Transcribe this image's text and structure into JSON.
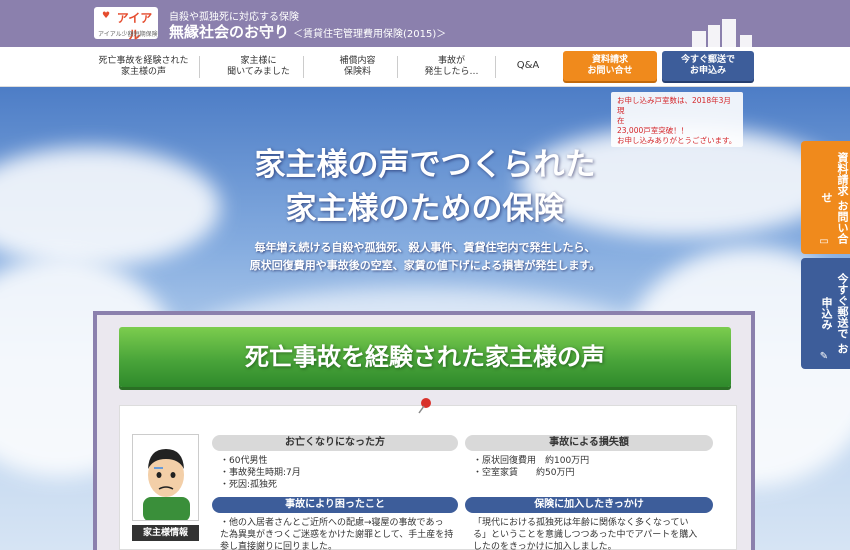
{
  "header": {
    "logo_brand": "アイアル",
    "logo_sub": "アイアル少額短期保険",
    "tagline": "自殺や孤独死に対応する保険",
    "title": "無縁社会のお守り",
    "title_sub": "＜賃貸住宅管理費用保険(2015)＞"
  },
  "nav": {
    "items": [
      {
        "line1": "死亡事故を経験された",
        "line2": "家主様の声"
      },
      {
        "line1": "家主様に",
        "line2": "聞いてみました"
      },
      {
        "line1": "補償内容",
        "line2": "保険料"
      },
      {
        "line1": "事故が",
        "line2": "発生したら…"
      }
    ],
    "qa": "Q&A",
    "request_button": {
      "line1": "資料請求",
      "line2": "お問い合せ"
    },
    "apply_button": {
      "line1": "今すぐ郵送で",
      "line2": "お申込み"
    }
  },
  "notice": {
    "line1": "お申し込み戸室数は、2018年3月現",
    "line2": "在",
    "line3": "23,000戸室突破！！",
    "line4": "お申し込みありがとうございます。"
  },
  "hero": {
    "title_line1": "家主様の声でつくられた",
    "title_line2": "家主様のための保険",
    "desc_line1": "毎年増え続ける自殺や孤独死、殺人事件、賃貸住宅内で発生したら、",
    "desc_line2": "原状回復費用や事故後の空室、家賃の値下げによる損害が発生します。"
  },
  "side": {
    "request": "資料請求 お問い合せ",
    "apply": "今すぐ郵送で お申込み"
  },
  "content": {
    "banner": "死亡事故を経験された家主様の声",
    "avatar_label": "家主様情報",
    "deceased": {
      "heading": "お亡くなりになった方",
      "items": [
        "・60代男性",
        "・事故発生時期:7月",
        "・死因:孤独死"
      ]
    },
    "loss": {
      "heading": "事故による損失額",
      "items": [
        "・原状回復費用　約100万円",
        "・空室家賃　　約50万円"
      ]
    },
    "trouble": {
      "heading": "事故により困ったこと",
      "line1": "・他の入居者さんとご近所への配慮→寝屋の事故であっ",
      "line2": "た為異臭がきつくご迷惑をかけた謝罪として、手土産を持",
      "line3": "参し直接謝りに回りました。"
    },
    "reason": {
      "heading": "保険に加入したきっかけ",
      "line1": "「現代における孤独死は年齢に関係なく多くなってい",
      "line2": "る」ということを意識しつつあった中でアパートを購入",
      "line3": "したのをきっかけに加入しました。"
    }
  },
  "colors": {
    "header": "#8b80ad",
    "orange": "#f08a1c",
    "navy": "#3d5d9a",
    "green": "#4aa53a"
  }
}
